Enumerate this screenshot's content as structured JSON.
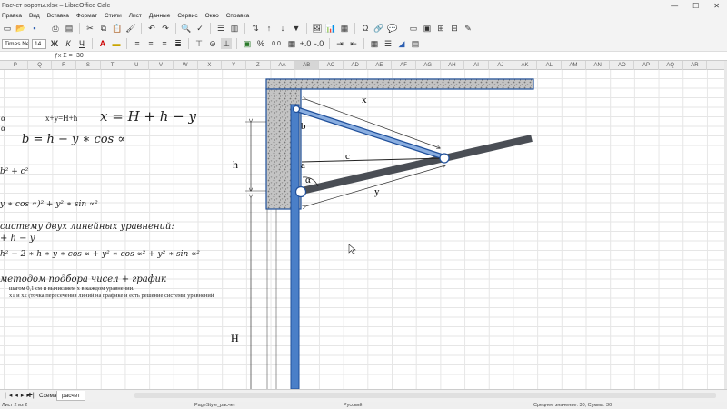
{
  "window": {
    "title": "Расчет вороты.xlsx – LibreOffice Calc",
    "minimize": "—",
    "maximize": "☐",
    "close": "✕"
  },
  "menu": [
    "Правка",
    "Вид",
    "Вставка",
    "Формат",
    "Стили",
    "Лист",
    "Данные",
    "Сервис",
    "Окно",
    "Справка"
  ],
  "toolbar": {
    "font_name": "Times New Roman",
    "font_size": "14",
    "bold": "Ж",
    "italic": "К",
    "underline": "Ч",
    "percent": "%",
    "decimals": "0.0"
  },
  "formula_bar": {
    "fx": "ƒx Σ =",
    "value": "30"
  },
  "columns": [
    "P",
    "Q",
    "R",
    "S",
    "T",
    "U",
    "V",
    "W",
    "X",
    "Y",
    "Z",
    "AA",
    "AB",
    "AC",
    "AD",
    "AE",
    "AF",
    "AG",
    "AH",
    "AI",
    "AJ",
    "AK",
    "AL",
    "AM",
    "AN",
    "AO",
    "AP",
    "AQ",
    "AR"
  ],
  "sheet_text": {
    "alpha1": "α",
    "alpha2": "α",
    "sum_eq": "x+y=H+h",
    "x_formula": "x = H + h − y",
    "b_formula": "b = h − y ∗ cos ∝",
    "sq_frag": "b² + c²",
    "expand_frag": "y ∗ cos ∝)² + y² ∗ sin ∝²",
    "system_title": "систему двух линейных уравнений:",
    "hy_frag": "+ h − y",
    "long_frag": "h² − 2 ∗ h ∗ y ∗ cos ∝ + y² ∗ cos ∝² + y² ∗ sin ∝²",
    "method_title": "методом подбора чисел + график",
    "step_note": "шагом 0,1 см и вычисляем х в каждом уравнении.",
    "graph_note": "x1 и x2 (точка пересечения линий на графике и есть решение системы уравнений"
  },
  "diagram_labels": {
    "x": "x",
    "b": "b",
    "c": "c",
    "a": "a",
    "alpha": "α",
    "y": "y",
    "h": "h",
    "H": "H"
  },
  "tabs": {
    "first": "Схема",
    "active": "расчет"
  },
  "status": {
    "sheet": "Лист 2 из 2",
    "page_style": "PageStyle_расчет",
    "language": "Русский",
    "calc": "Среднее значение: 30; Сумма: 30"
  }
}
